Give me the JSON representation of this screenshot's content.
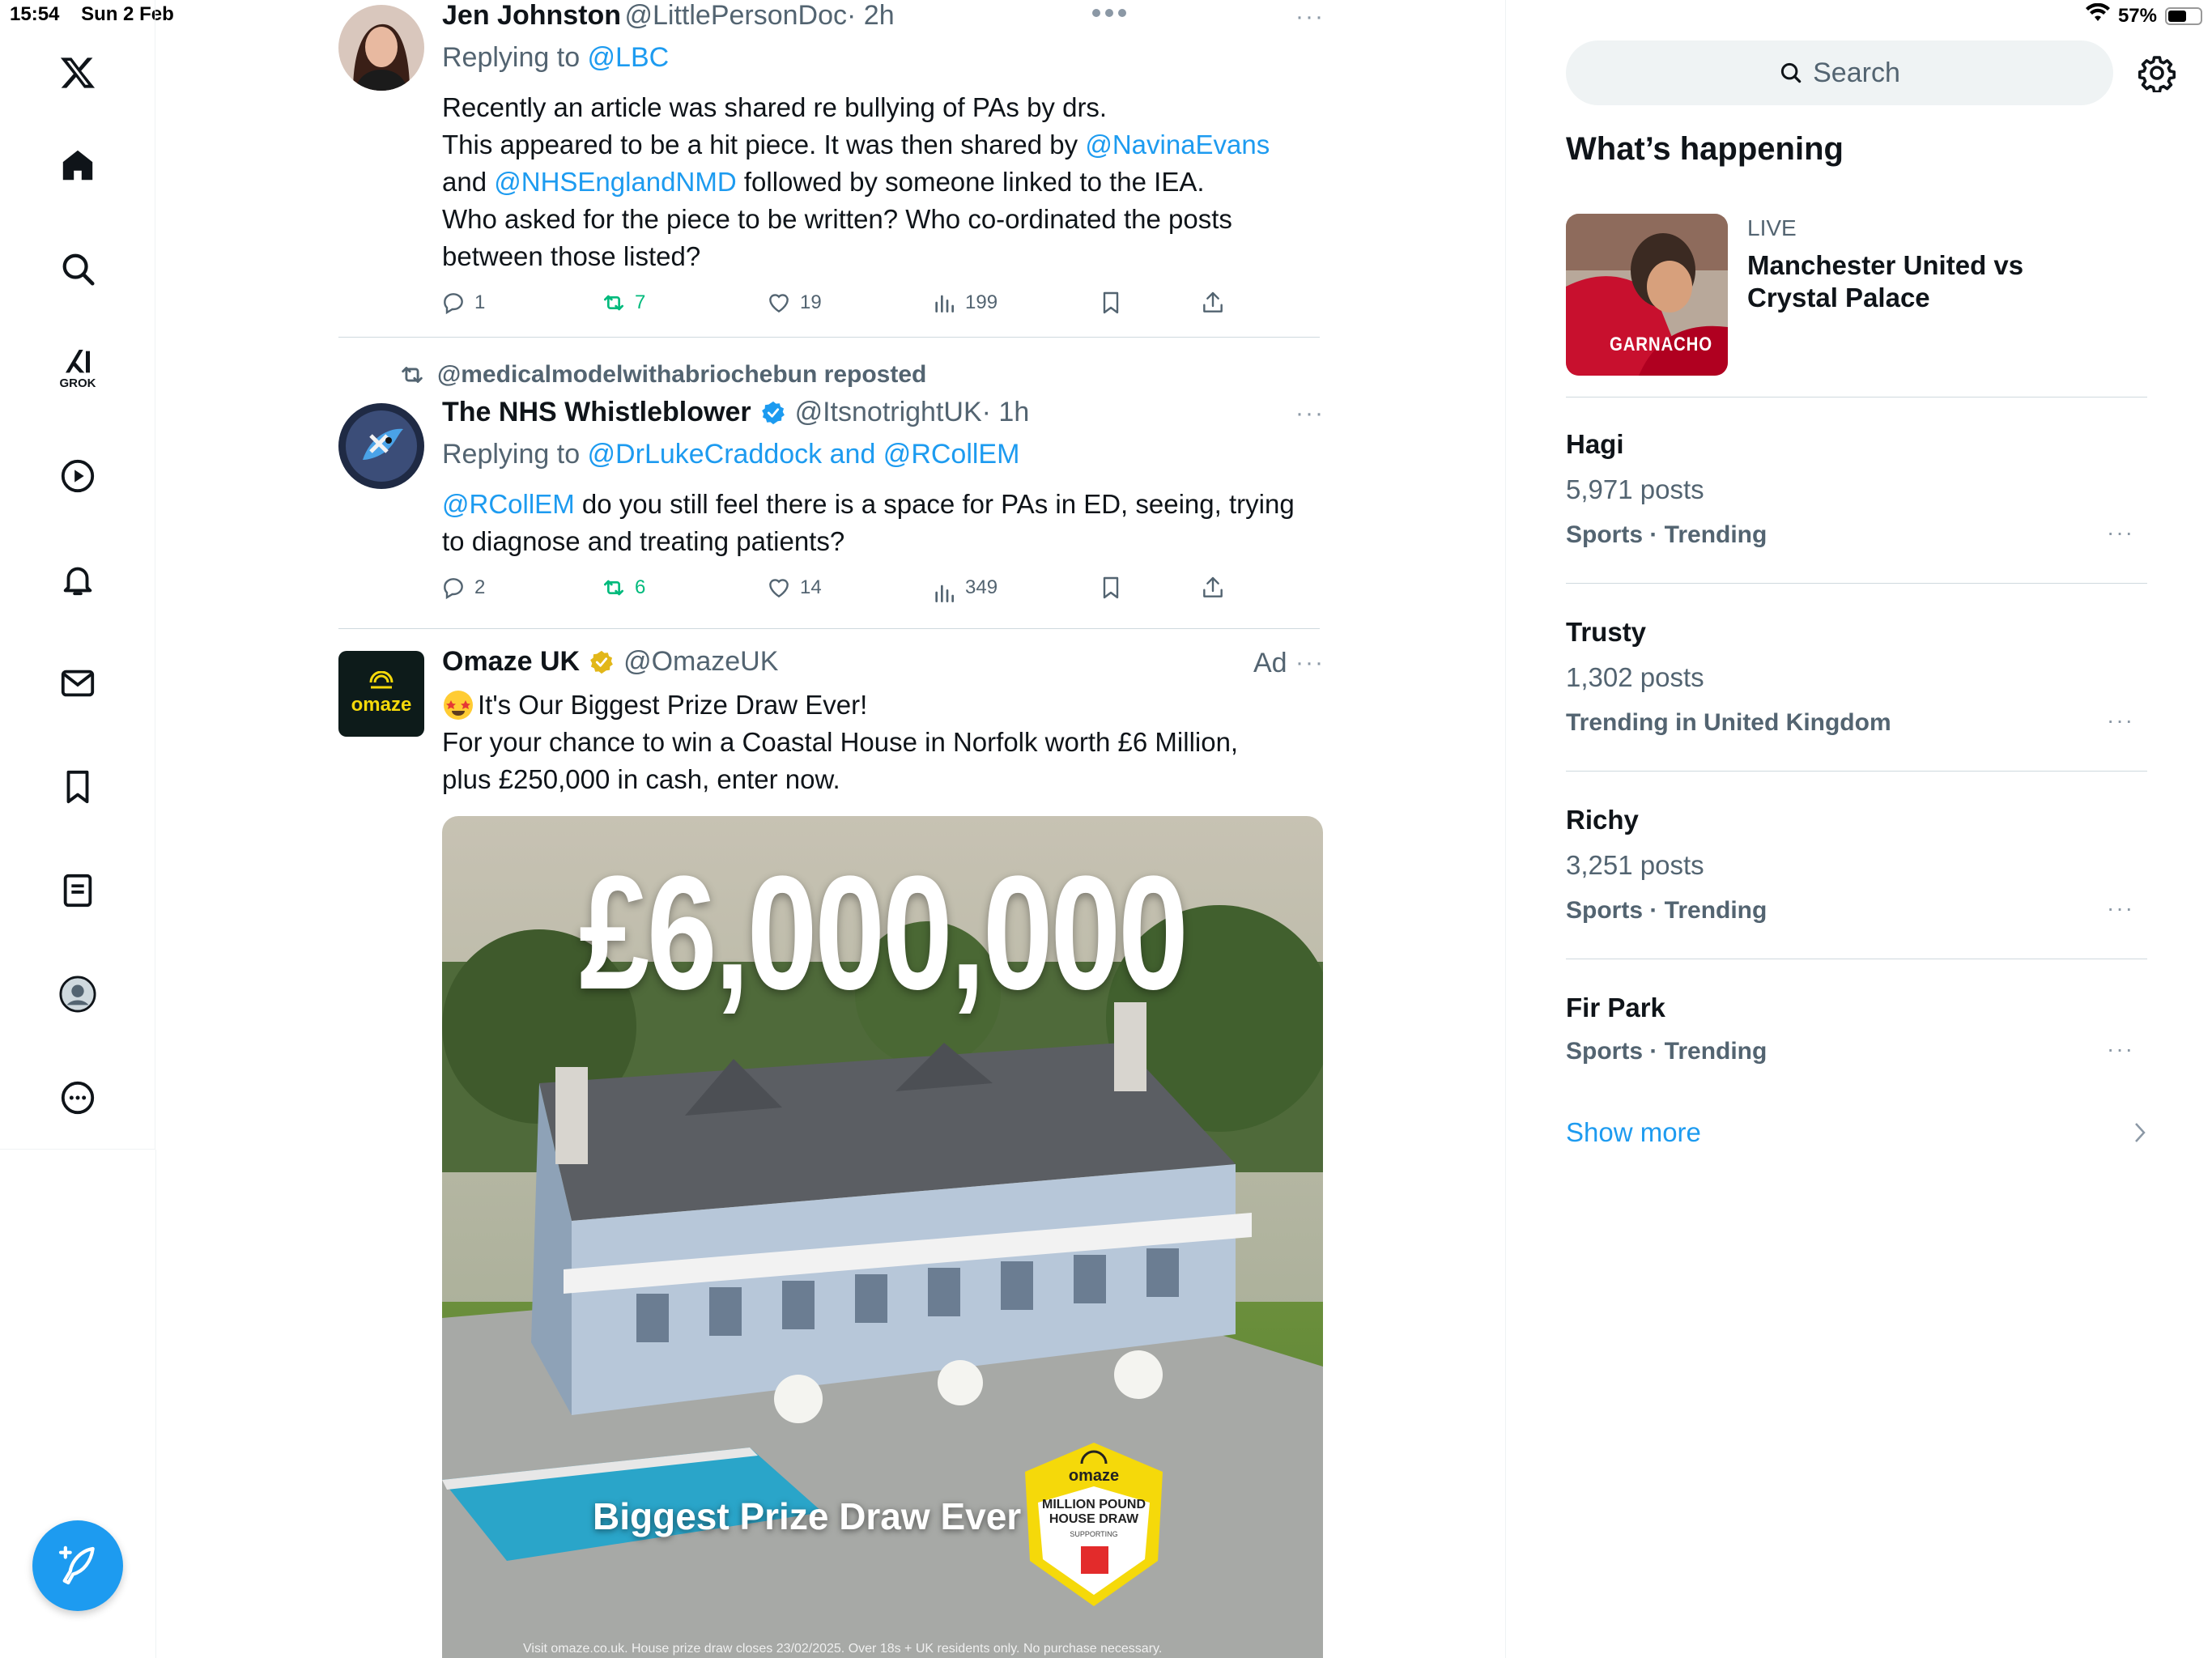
{
  "status_bar": {
    "time": "15:54",
    "date": "Sun 2 Feb",
    "battery": "57%",
    "battery_level": 0.57
  },
  "nav": {
    "items": [
      {
        "name": "x-logo-icon"
      },
      {
        "name": "home-icon"
      },
      {
        "name": "explore-search-icon"
      },
      {
        "name": "grok-icon",
        "label": "GROK"
      },
      {
        "name": "video-play-icon"
      },
      {
        "name": "notifications-bell-icon"
      },
      {
        "name": "messages-mail-icon"
      },
      {
        "name": "bookmarks-icon"
      },
      {
        "name": "lists-icon"
      },
      {
        "name": "profile-avatar-icon"
      },
      {
        "name": "more-options-icon"
      }
    ],
    "compose_icon": "compose-feather-icon"
  },
  "tweets": [
    {
      "name": "Jen Johnston",
      "handle": "@LittlePersonDoc",
      "time": "· 2h",
      "replying_prefix": "Replying to ",
      "replying_to": "@LBC",
      "line1": "Recently an article was shared re bullying of PAs by drs.",
      "line2_pre": "This appeared to be a hit piece. It was then shared by ",
      "line2_link": "@NavinaEvans",
      "line3_pre": "and ",
      "line3_link": "@NHSEnglandNMD",
      "line3_post": " followed by someone linked to the IEA.",
      "line4": "Who asked for the piece to be written? Who co-ordinated the posts",
      "line5": "between those listed?",
      "replies": "1",
      "reposts": "7",
      "likes": "19",
      "views": "199"
    },
    {
      "repost_label": "@medicalmodelwithabriochebun reposted",
      "name": "The NHS Whistleblower",
      "handle": "@ItsnotrightUK",
      "time": "· 1h",
      "replying_prefix": "Replying to ",
      "replying_to": "@DrLukeCraddock and @RCollEM",
      "line1_link": "@RCollEM",
      "line1_post": " do you still feel there is a space for PAs in ED, seeing, trying",
      "line2": "to diagnose and treating patients?",
      "replies": "2",
      "reposts": "6",
      "likes": "14",
      "views": "349"
    },
    {
      "name": "Omaze UK",
      "handle": "@OmazeUK",
      "ad_label": "Ad",
      "avatar_text": "omaze",
      "line1": "It's Our Biggest Prize Draw Ever!",
      "line2": "For your chance to win a Coastal House in Norfolk worth £6 Million,",
      "line3": "plus £250,000 in cash, enter now.",
      "image_amount": "£6,000,000",
      "image_caption": "Biggest Prize Draw Ever",
      "badge_brand": "omaze",
      "badge_line1": "MILLION POUND",
      "badge_line2": "HOUSE DRAW",
      "badge_supporting": "SUPPORTING",
      "fine_print": "Visit omaze.co.uk. House prize draw closes 23/02/2025. Over 18s + UK residents only. No purchase necessary."
    }
  ],
  "sidebar": {
    "search_placeholder": "Search",
    "section_title": "What’s happening",
    "live": {
      "label": "LIVE",
      "title_line1": "Manchester United vs",
      "title_line2": "Crystal Palace",
      "image_text": "GARNACHO"
    },
    "trends": [
      {
        "title": "Hagi",
        "count": "5,971 posts",
        "context": "Sports · Trending"
      },
      {
        "title": "Trusty",
        "count": "1,302 posts",
        "context": "Trending in United Kingdom"
      },
      {
        "title": "Richy",
        "count": "3,251 posts",
        "context": "Sports · Trending"
      },
      {
        "title": "Fir Park",
        "context": "Sports · Trending"
      }
    ],
    "show_more": "Show more"
  },
  "colors": {
    "accent": "#1d9bf0",
    "repost_green": "#00ba7c",
    "muted": "#536471"
  }
}
